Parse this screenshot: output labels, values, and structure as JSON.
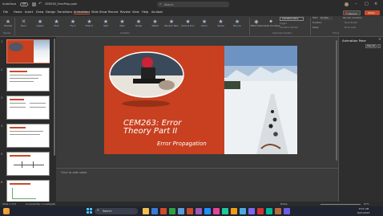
{
  "titlebar": {
    "autosave": "AutoSave",
    "autosave_state": "Off",
    "filename": "CEM263_ErrorProp.pptx",
    "search_placeholder": "Search",
    "record_label": "Record",
    "share_label": "Share"
  },
  "menu": {
    "items": [
      "File",
      "Home",
      "Insert",
      "Draw",
      "Design",
      "Transitions",
      "Animations",
      "Slide Show",
      "Record",
      "Review",
      "View",
      "Help",
      "Acrobat"
    ],
    "active": "Animations"
  },
  "ribbon": {
    "preview_label": "Preview",
    "animations": [
      "None",
      "Appear",
      "Fade",
      "Fly In",
      "Float In",
      "Split",
      "Wipe",
      "Shape",
      "Wheel",
      "Random Bars",
      "Grow & Turn",
      "Zoom",
      "Swivel",
      "Bounce"
    ],
    "effect_options": "Effect Options",
    "add_animation": "Add Animation",
    "animation_pane": "Animation Pane",
    "trigger": "Trigger",
    "animation_painter": "Animation Painter",
    "start": "Start:",
    "start_value": "On Click",
    "duration": "Duration:",
    "delay": "Delay:",
    "reorder": "Reorder Animation",
    "move_earlier": "Move Earlier",
    "move_later": "Move Later",
    "group_preview": "Preview",
    "group_animation": "Animation",
    "group_advanced": "Advanced Animation",
    "group_timing": "Timing"
  },
  "thumbnails": [
    {
      "num": "1"
    },
    {
      "num": "2"
    },
    {
      "num": "3"
    },
    {
      "num": "4"
    },
    {
      "num": "5"
    },
    {
      "num": "6"
    }
  ],
  "slide": {
    "title_line1": "CEM263:  Error",
    "title_line2": "Theory Part II",
    "subtitle": "Error Propagation"
  },
  "notes_placeholder": "Click to add notes",
  "animation_pane": {
    "title": "Animation Pane",
    "play": "Play All"
  },
  "status": {
    "slide_info": "Slide 1 of 6",
    "accessibility": "Accessibility: Investigate",
    "notes": "Notes",
    "zoom": "67%"
  },
  "taskbar": {
    "search_placeholder": "Search",
    "time": "8:52 AM",
    "date": "8/21/2023"
  },
  "colors": {
    "accent": "#c94a2b",
    "slide_left": "#c8401f"
  }
}
